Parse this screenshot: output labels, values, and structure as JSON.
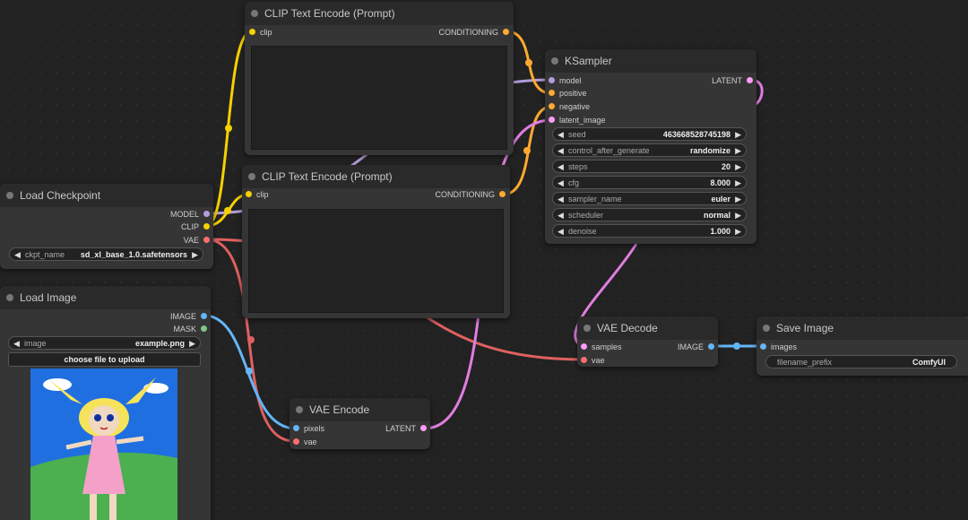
{
  "nodes": {
    "clip_text_encode_top": {
      "title": "CLIP Text Encode (Prompt)",
      "input_clip": "clip",
      "output_conditioning": "CONDITIONING",
      "text": ""
    },
    "clip_text_encode_bottom": {
      "title": "CLIP Text Encode (Prompt)",
      "input_clip": "clip",
      "output_conditioning": "CONDITIONING",
      "text": ""
    },
    "ksampler": {
      "title": "KSampler",
      "inputs": {
        "model": "model",
        "positive": "positive",
        "negative": "negative",
        "latent_image": "latent_image"
      },
      "output_latent": "LATENT",
      "widgets": {
        "seed": {
          "label": "seed",
          "value": "463668528745198"
        },
        "control_after_generate": {
          "label": "control_after_generate",
          "value": "randomize"
        },
        "steps": {
          "label": "steps",
          "value": "20"
        },
        "cfg": {
          "label": "cfg",
          "value": "8.000"
        },
        "sampler_name": {
          "label": "sampler_name",
          "value": "euler"
        },
        "scheduler": {
          "label": "scheduler",
          "value": "normal"
        },
        "denoise": {
          "label": "denoise",
          "value": "1.000"
        }
      }
    },
    "load_checkpoint": {
      "title": "Load Checkpoint",
      "outputs": {
        "model": "MODEL",
        "clip": "CLIP",
        "vae": "VAE"
      },
      "ckpt_name": {
        "label": "ckpt_name",
        "value": "sd_xl_base_1.0.safetensors"
      }
    },
    "load_image": {
      "title": "Load Image",
      "outputs": {
        "image": "IMAGE",
        "mask": "MASK"
      },
      "image": {
        "label": "image",
        "value": "example.png"
      },
      "upload_button": "choose file to upload"
    },
    "vae_encode": {
      "title": "VAE Encode",
      "inputs": {
        "pixels": "pixels",
        "vae": "vae"
      },
      "output_latent": "LATENT"
    },
    "vae_decode": {
      "title": "VAE Decode",
      "inputs": {
        "samples": "samples",
        "vae": "vae"
      },
      "output_image": "IMAGE"
    },
    "save_image": {
      "title": "Save Image",
      "input_images": "images",
      "filename_prefix": {
        "label": "filename_prefix",
        "value": "ComfyUI"
      }
    }
  },
  "colors": {
    "canvas": "#222222",
    "node_body": "#353535",
    "node_title": "#2a2a2a",
    "model": "#b39ddb",
    "clip": "#f5d100",
    "vae": "#ff6e6e",
    "conditioning": "#ffa931",
    "latent": "#ff9cf9",
    "image": "#64b5f6",
    "mask": "#81c784"
  }
}
